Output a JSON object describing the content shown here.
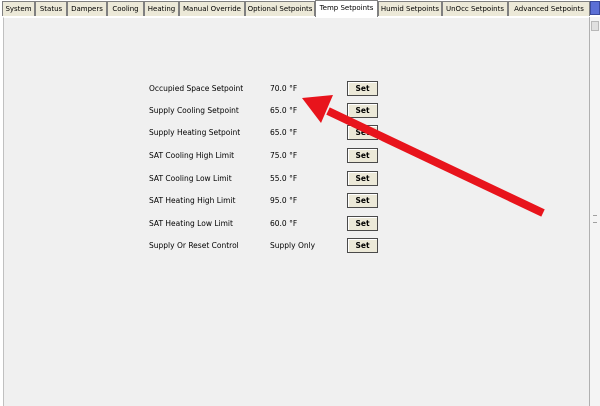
{
  "tabs": [
    {
      "label": "System"
    },
    {
      "label": "Status"
    },
    {
      "label": "Dampers"
    },
    {
      "label": "Cooling"
    },
    {
      "label": "Heating"
    },
    {
      "label": "Manual Override"
    },
    {
      "label": "Optional Setpoints"
    },
    {
      "label": "Temp Setpoints",
      "active": true
    },
    {
      "label": "Humid Setpoints"
    },
    {
      "label": "UnOcc Setpoints"
    },
    {
      "label": "Advanced Setpoints"
    }
  ],
  "setpoints": [
    {
      "label": "Occupied Space Setpoint",
      "value": "70.0 °F",
      "button": "Set"
    },
    {
      "label": "Supply Cooling Setpoint",
      "value": "65.0 °F",
      "button": "Set"
    },
    {
      "label": "Supply Heating Setpoint",
      "value": "65.0 °F",
      "button": "Set"
    },
    {
      "label": "SAT Cooling High Limit",
      "value": "75.0 °F",
      "button": "Set"
    },
    {
      "label": "SAT Cooling Low Limit",
      "value": "55.0 °F",
      "button": "Set"
    },
    {
      "label": "SAT Heating High Limit",
      "value": "95.0 °F",
      "button": "Set"
    },
    {
      "label": "SAT Heating Low Limit",
      "value": "60.0 °F",
      "button": "Set"
    },
    {
      "label": "Supply Or Reset Control",
      "value": "Supply Only",
      "button": "Set"
    }
  ],
  "colors": {
    "annotation_arrow": "#e8141c",
    "tab_corner": "#5b6fd6",
    "panel_background": "#f0f0f0"
  }
}
